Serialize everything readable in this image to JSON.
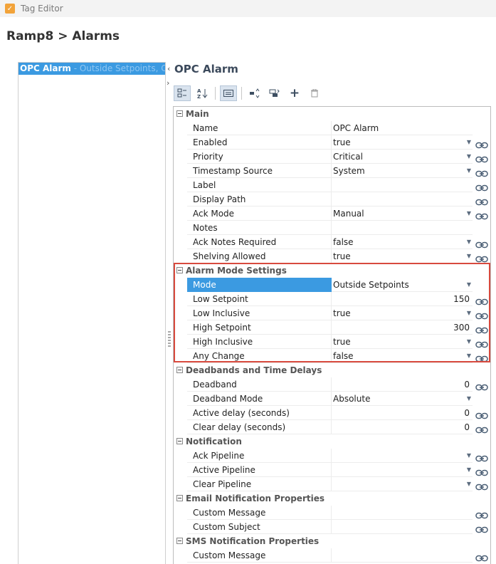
{
  "window": {
    "title": "Tag Editor"
  },
  "breadcrumb": "Ramp8 > Alarms",
  "alarm_list": [
    {
      "name": "OPC Alarm",
      "detail": " - Outside Setpoints, Critical"
    }
  ],
  "panel": {
    "title": "OPC Alarm"
  },
  "toolbar": [
    "categorized-view",
    "alphabetical-sort",
    "edit-mode",
    "move-up-down",
    "expand-collapse",
    "add",
    "delete"
  ],
  "sections": [
    {
      "label": "Main",
      "props": [
        {
          "name": "Name",
          "value": "OPC Alarm",
          "dropdown": false,
          "link": false
        },
        {
          "name": "Enabled",
          "value": "true",
          "dropdown": true,
          "link": true
        },
        {
          "name": "Priority",
          "value": "Critical",
          "dropdown": true,
          "link": true
        },
        {
          "name": "Timestamp Source",
          "value": "System",
          "dropdown": true,
          "link": true
        },
        {
          "name": "Label",
          "value": "",
          "dropdown": false,
          "link": true
        },
        {
          "name": "Display Path",
          "value": "",
          "dropdown": false,
          "link": true
        },
        {
          "name": "Ack Mode",
          "value": "Manual",
          "dropdown": true,
          "link": true
        },
        {
          "name": "Notes",
          "value": "",
          "dropdown": false,
          "link": false
        },
        {
          "name": "Ack Notes Required",
          "value": "false",
          "dropdown": true,
          "link": true
        },
        {
          "name": "Shelving Allowed",
          "value": "true",
          "dropdown": true,
          "link": true
        }
      ]
    },
    {
      "label": "Alarm Mode Settings",
      "props": [
        {
          "name": "Mode",
          "value": "Outside Setpoints",
          "dropdown": true,
          "link": false,
          "selected": true
        },
        {
          "name": "Low Setpoint",
          "value": "150",
          "numeric": true,
          "dropdown": false,
          "link": true
        },
        {
          "name": "Low Inclusive",
          "value": "true",
          "dropdown": true,
          "link": true
        },
        {
          "name": "High Setpoint",
          "value": "300",
          "numeric": true,
          "dropdown": false,
          "link": true
        },
        {
          "name": "High Inclusive",
          "value": "true",
          "dropdown": true,
          "link": true
        },
        {
          "name": "Any Change",
          "value": "false",
          "dropdown": true,
          "link": true
        }
      ]
    },
    {
      "label": "Deadbands and Time Delays",
      "props": [
        {
          "name": "Deadband",
          "value": "0",
          "numeric": true,
          "dropdown": false,
          "link": true
        },
        {
          "name": "Deadband Mode",
          "value": "Absolute",
          "dropdown": true,
          "link": false
        },
        {
          "name": "Active delay (seconds)",
          "value": "0",
          "numeric": true,
          "dropdown": false,
          "link": true
        },
        {
          "name": "Clear delay (seconds)",
          "value": "0",
          "numeric": true,
          "dropdown": false,
          "link": true
        }
      ]
    },
    {
      "label": "Notification",
      "props": [
        {
          "name": "Ack Pipeline",
          "value": "",
          "dropdown": true,
          "link": true
        },
        {
          "name": "Active Pipeline",
          "value": "",
          "dropdown": true,
          "link": true
        },
        {
          "name": "Clear Pipeline",
          "value": "",
          "dropdown": true,
          "link": true
        }
      ]
    },
    {
      "label": "Email Notification Properties",
      "props": [
        {
          "name": "Custom Message",
          "value": "",
          "dropdown": false,
          "link": true
        },
        {
          "name": "Custom Subject",
          "value": "",
          "dropdown": false,
          "link": true
        }
      ]
    },
    {
      "label": "SMS Notification Properties",
      "props": [
        {
          "name": "Custom Message",
          "value": "",
          "dropdown": false,
          "link": true
        }
      ]
    }
  ],
  "colors": {
    "selection": "#3b9ae1",
    "highlight_border": "#d84a3e"
  }
}
